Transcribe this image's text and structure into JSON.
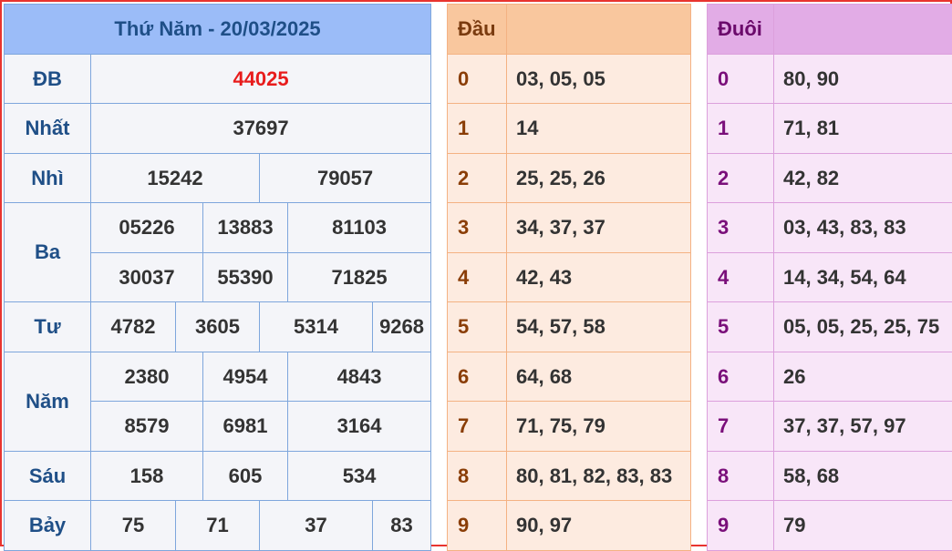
{
  "results": {
    "title": "Thứ Năm - 20/03/2025",
    "rows": [
      {
        "label": "ĐB",
        "numbers": [
          "44025"
        ]
      },
      {
        "label": "Nhất",
        "numbers": [
          "37697"
        ]
      },
      {
        "label": "Nhì",
        "numbers": [
          "15242",
          "79057"
        ]
      },
      {
        "label": "Ba",
        "numbers": [
          "05226",
          "13883",
          "81103",
          "30037",
          "55390",
          "71825"
        ]
      },
      {
        "label": "Tư",
        "numbers": [
          "4782",
          "3605",
          "5314",
          "9268"
        ]
      },
      {
        "label": "Năm",
        "numbers": [
          "2380",
          "4954",
          "4843",
          "8579",
          "6981",
          "3164"
        ]
      },
      {
        "label": "Sáu",
        "numbers": [
          "158",
          "605",
          "534"
        ]
      },
      {
        "label": "Bảy",
        "numbers": [
          "75",
          "71",
          "37",
          "83"
        ]
      }
    ]
  },
  "dau": {
    "header": "Đầu",
    "rows": [
      {
        "key": "0",
        "values": "03, 05, 05"
      },
      {
        "key": "1",
        "values": "14"
      },
      {
        "key": "2",
        "values": "25, 25, 26"
      },
      {
        "key": "3",
        "values": "34, 37, 37"
      },
      {
        "key": "4",
        "values": "42, 43"
      },
      {
        "key": "5",
        "values": "54, 57, 58"
      },
      {
        "key": "6",
        "values": "64, 68"
      },
      {
        "key": "7",
        "values": "71, 75, 79"
      },
      {
        "key": "8",
        "values": "80, 81, 82, 83, 83"
      },
      {
        "key": "9",
        "values": "90, 97"
      }
    ]
  },
  "duoi": {
    "header": "Đuôi",
    "rows": [
      {
        "key": "0",
        "values": "80, 90"
      },
      {
        "key": "1",
        "values": "71, 81"
      },
      {
        "key": "2",
        "values": "42, 82"
      },
      {
        "key": "3",
        "values": "03, 43, 83, 83"
      },
      {
        "key": "4",
        "values": "14, 34, 54, 64"
      },
      {
        "key": "5",
        "values": "05, 05, 25, 25, 75"
      },
      {
        "key": "6",
        "values": "26"
      },
      {
        "key": "7",
        "values": "37, 37, 57, 97"
      },
      {
        "key": "8",
        "values": "58, 68"
      },
      {
        "key": "9",
        "values": "79"
      }
    ]
  }
}
